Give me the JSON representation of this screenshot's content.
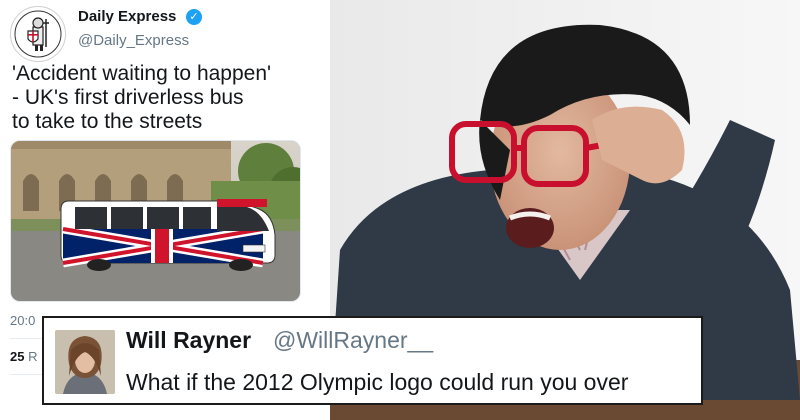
{
  "tweet": {
    "account_name": "Daily Express",
    "account_handle": "@Daily_Express",
    "verified": true,
    "headline_lines": [
      "'Accident waiting to happen'",
      "- UK's first driverless bus",
      "to take to the streets"
    ],
    "time_partial": "20:0",
    "retweets_partial": "25",
    "retweets_label_partial": "R"
  },
  "reply": {
    "name": "Will Rayner",
    "handle": "@WillRayner__",
    "text": "What if the 2012 Olympic logo could run you over"
  },
  "icons": {
    "verified": "verified-check-icon",
    "logo": "crusader-knight-logo"
  },
  "colors": {
    "twitter_blue": "#1da1f2",
    "bus_red": "#cf142b",
    "bus_blue": "#012169",
    "glasses_red": "#c8102e"
  }
}
